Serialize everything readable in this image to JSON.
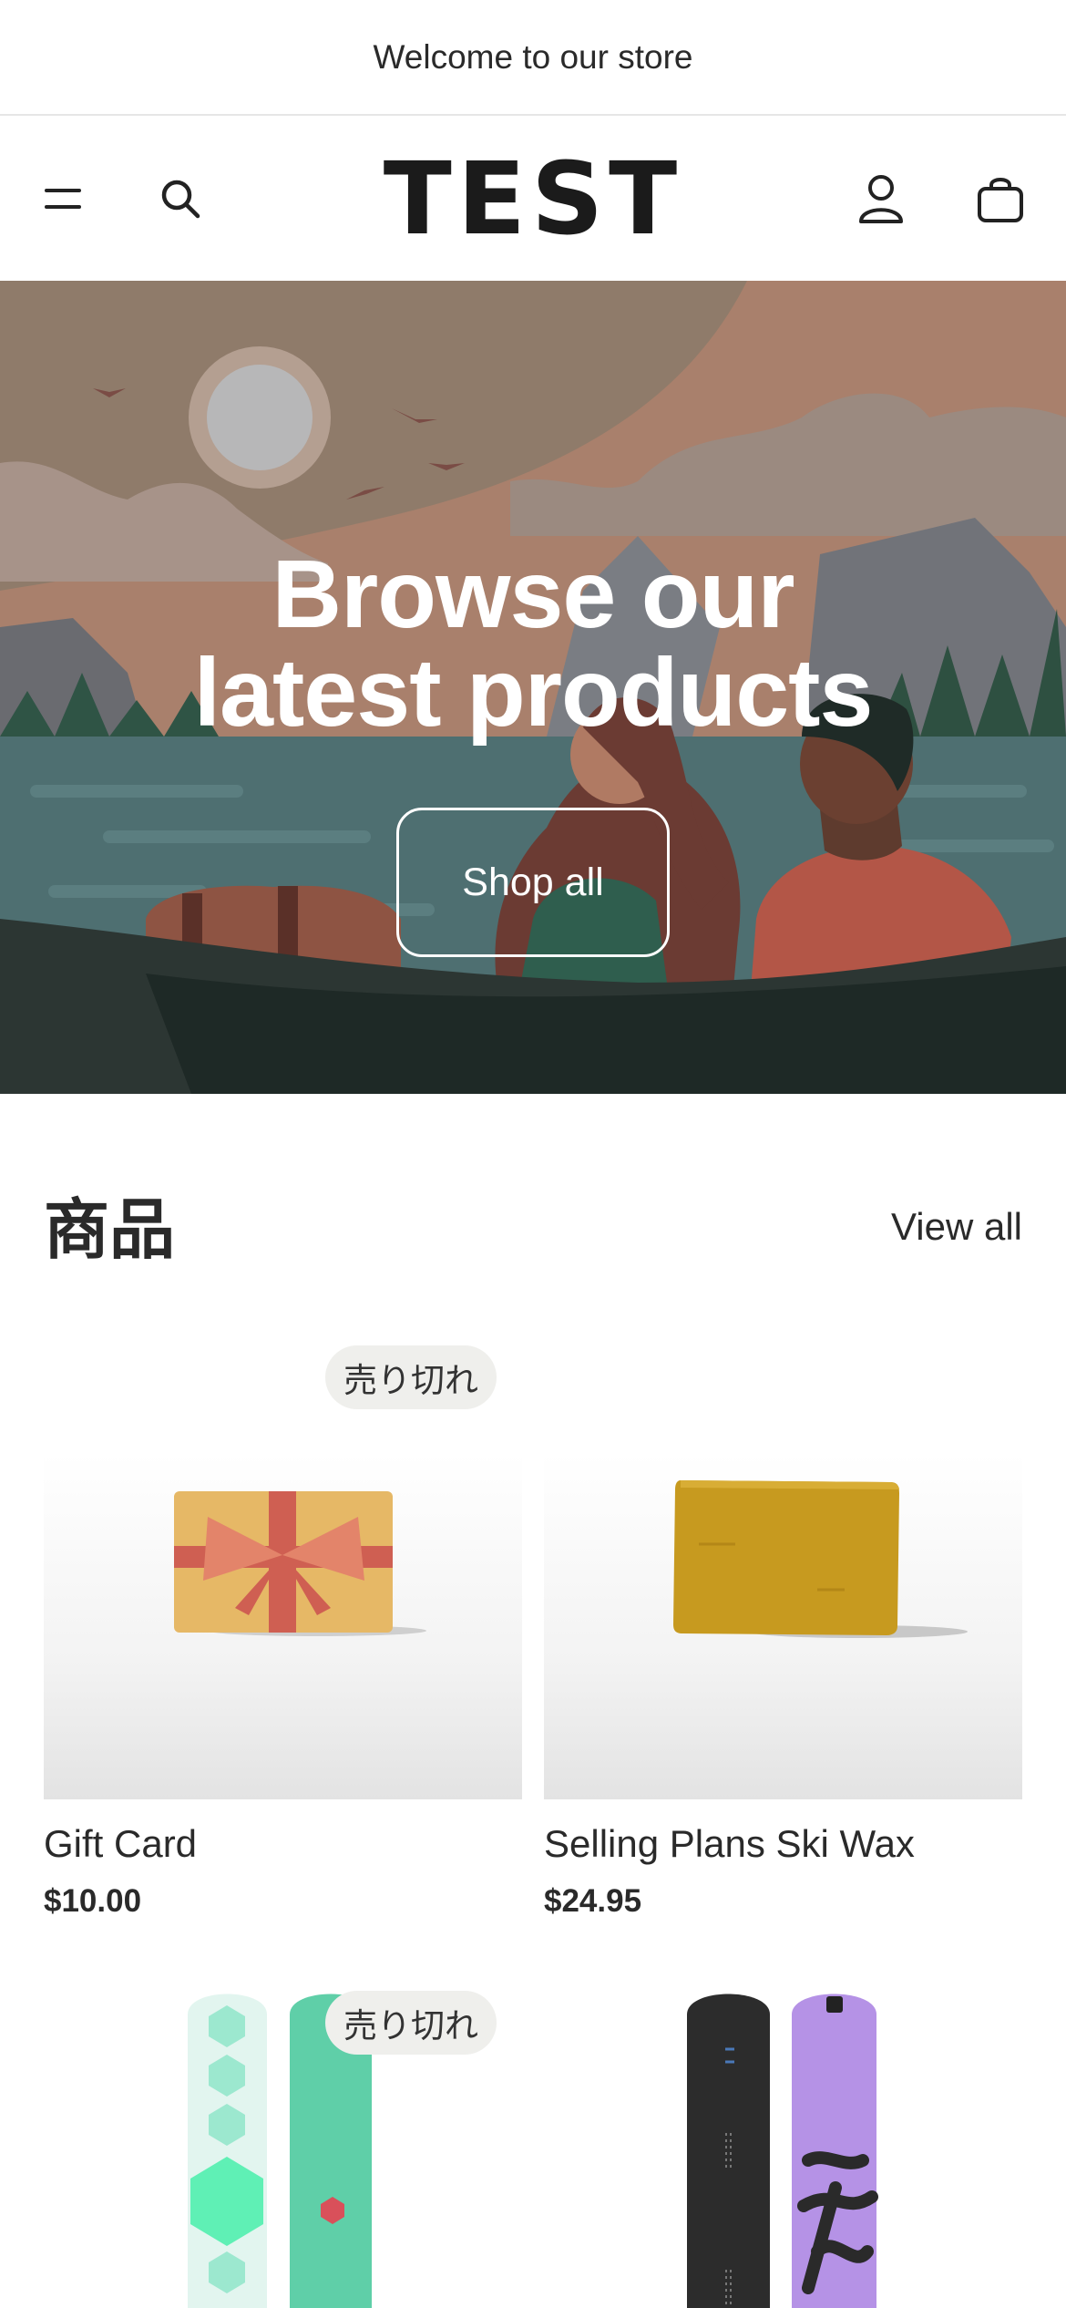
{
  "announcement": {
    "text": "Welcome to our store"
  },
  "header": {
    "logo": "TEST",
    "icons": [
      "menu-icon",
      "search-icon",
      "account-icon",
      "cart-icon"
    ]
  },
  "hero": {
    "title_line1": "Browse our",
    "title_line2": "latest products",
    "button_label": "Shop all"
  },
  "collection": {
    "title": "商品",
    "view_all": "View all",
    "products": [
      {
        "name": "Gift Card",
        "price": "$10.00",
        "badge": "売り切れ"
      },
      {
        "name": "Selling Plans Ski Wax",
        "price": "$24.95",
        "badge": ""
      },
      {
        "name": "",
        "price": "",
        "badge": "売り切れ"
      },
      {
        "name": "",
        "price": "",
        "badge": ""
      }
    ]
  },
  "colors": {
    "text": "#1f1f1f",
    "badge_bg": "#efefec",
    "hero_sky": "#8e7a6a",
    "hero_water": "#4e6f71"
  }
}
